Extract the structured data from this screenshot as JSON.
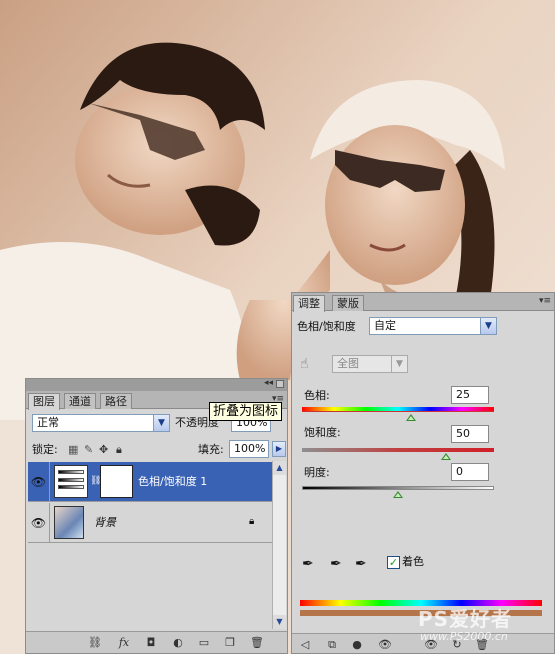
{
  "layers_panel": {
    "tabs": [
      "图层",
      "通道",
      "路径"
    ],
    "blend_mode": "正常",
    "opacity_label": "不透明度",
    "opacity_value": "100%",
    "lock_label": "锁定:",
    "fill_label": "填充:",
    "fill_value": "100%",
    "collapse_glyph": "◂◂",
    "layers": [
      {
        "name": "色相/饱和度 1",
        "type": "adjustment",
        "selected": true
      },
      {
        "name": "背景",
        "type": "background",
        "selected": false
      }
    ]
  },
  "tooltip": "折叠为图标",
  "adjust_panel": {
    "tabs": [
      "调整",
      "蒙版"
    ],
    "title": "色相/饱和度",
    "preset": "自定",
    "channel": "全图",
    "hue_label": "色相:",
    "hue_value": "25",
    "saturation_label": "饱和度:",
    "saturation_value": "50",
    "lightness_label": "明度:",
    "lightness_value": "0",
    "colorize_label": "着色",
    "colorize_checked": true,
    "hue_range": [
      -180,
      180
    ],
    "saturation_range": [
      -100,
      100
    ],
    "lightness_range": [
      -100,
      100
    ]
  },
  "watermark": {
    "main": "PS爱好者",
    "url": "www.PS2000.cn"
  },
  "colors": {
    "selected_row": "#3a62b4",
    "annotation_circle": "#e8323c",
    "sepia": "#d9b59a"
  },
  "icons": [
    "eye-icon",
    "link-icon",
    "fx-icon",
    "mask-icon",
    "adjustment-layer-icon",
    "folder-icon",
    "new-layer-icon",
    "trash-icon",
    "eyedropper-icon",
    "hand-icon",
    "lock-icon"
  ]
}
